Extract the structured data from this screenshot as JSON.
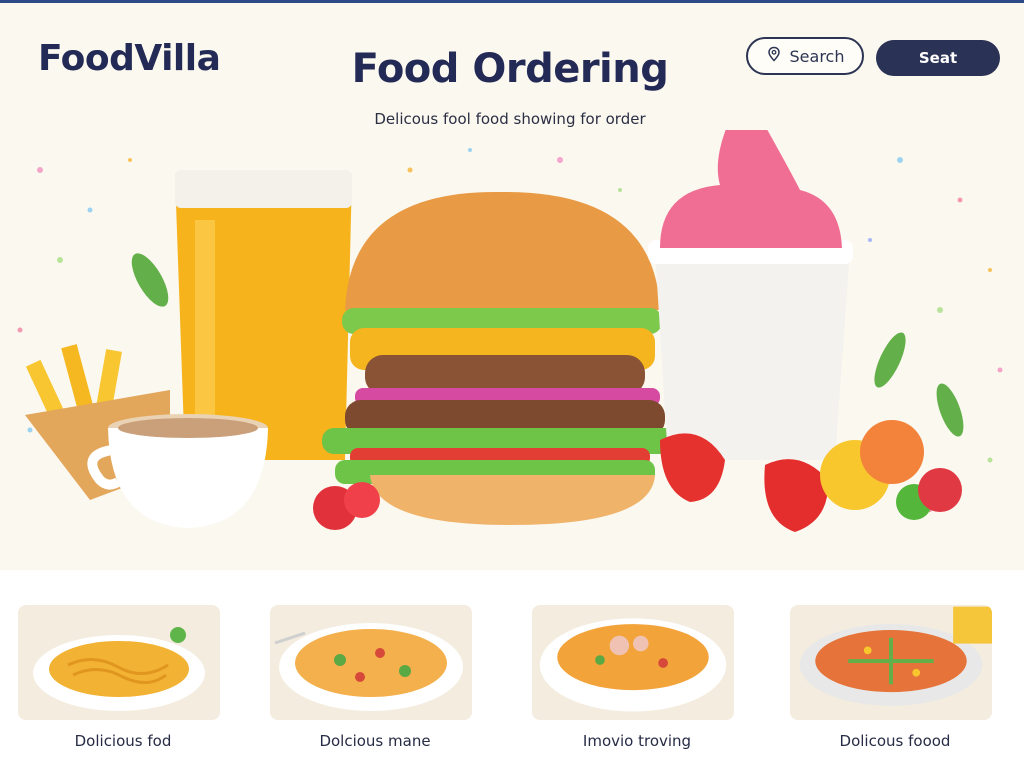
{
  "header": {
    "brand": "FoodVilla",
    "title": "Food Ordering",
    "subtitle": "Delicous fool food showing for order",
    "search_label": "Search",
    "seat_label": "Seat"
  },
  "cards": [
    {
      "caption": "Dolicious fod",
      "icon": "spaghetti-plate"
    },
    {
      "caption": "Dolcious mane",
      "icon": "pasta-plate"
    },
    {
      "caption": "Imovio troving",
      "icon": "soup-bowl"
    },
    {
      "caption": "Dolicous foood",
      "icon": "pizza-plate"
    }
  ],
  "colors": {
    "accent": "#2a3255",
    "background": "#fbf8ef",
    "card": "#f3ecdf"
  }
}
